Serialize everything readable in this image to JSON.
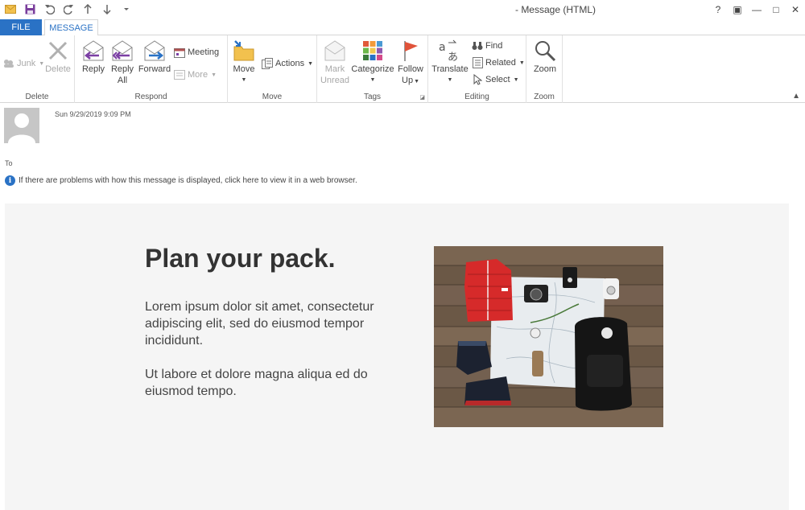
{
  "window": {
    "title": "- Message (HTML)",
    "controls": [
      "?",
      "▣",
      "—",
      "□",
      "✕"
    ]
  },
  "tabs": {
    "file": "FILE",
    "message": "MESSAGE"
  },
  "ribbon": {
    "delete_group": {
      "label": "Delete",
      "junk": "Junk",
      "delete": "Delete"
    },
    "respond_group": {
      "label": "Respond",
      "reply": "Reply",
      "reply_all_1": "Reply",
      "reply_all_2": "All",
      "forward": "Forward",
      "meeting": "Meeting",
      "more": "More"
    },
    "move_group": {
      "label": "Move",
      "move": "Move",
      "actions": "Actions"
    },
    "tags_group": {
      "label": "Tags",
      "mark_unread_1": "Mark",
      "mark_unread_2": "Unread",
      "categorize": "Categorize",
      "follow_up_1": "Follow",
      "follow_up_2": "Up"
    },
    "editing_group": {
      "label": "Editing",
      "translate": "Translate",
      "find": "Find",
      "related": "Related",
      "select": "Select"
    },
    "zoom_group": {
      "label": "Zoom",
      "zoom": "Zoom"
    }
  },
  "message": {
    "date": "Sun 9/29/2019 9:09 PM",
    "to_label": "To",
    "info_bar": "If there are problems with how this message is displayed, click here to view it in a web browser."
  },
  "email": {
    "headline": "Plan your pack.",
    "paragraph_1": "Lorem ipsum dolor sit amet, consectetur adipiscing elit, sed do eiusmod tempor incididunt.",
    "paragraph_2": "Ut labore et dolore magna aliqua ed do eiusmod tempo."
  },
  "colors": {
    "accent": "#2a72c5",
    "body_bg": "#f5f5f5",
    "headline": "#333333"
  }
}
